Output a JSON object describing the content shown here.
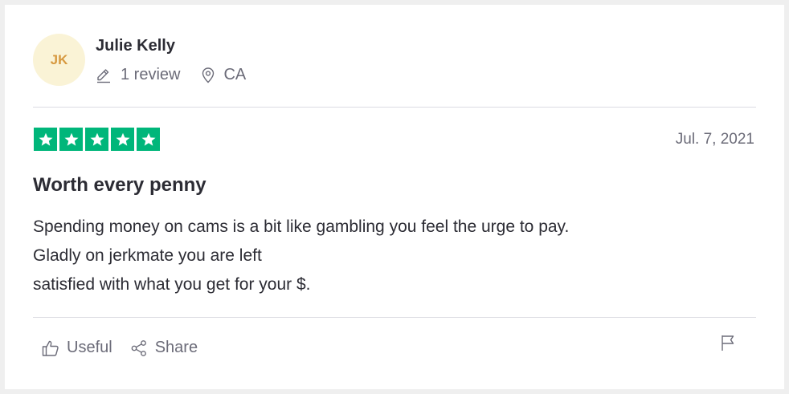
{
  "reviewer": {
    "initials": "JK",
    "name": "Julie Kelly",
    "review_count": "1 review",
    "location": "CA"
  },
  "review": {
    "rating": 5,
    "rating_max": 5,
    "date": "Jul. 7, 2021",
    "title": "Worth every penny",
    "body_lines": [
      "Spending money on cams is a bit like gambling you feel the urge to pay.",
      "Gladly on jerkmate you are left",
      "satisfied with what you get for your $."
    ]
  },
  "actions": {
    "useful_label": "Useful",
    "share_label": "Share"
  },
  "colors": {
    "star_green": "#00b67a",
    "avatar_bg": "#faf3d6",
    "avatar_text": "#d79940",
    "text_primary": "#2c2c34",
    "text_secondary": "#6b6b78",
    "page_bg": "#efefef"
  },
  "icons": [
    "pencil-icon",
    "location-pin-icon",
    "star-icon",
    "thumbs-up-icon",
    "share-icon",
    "flag-icon"
  ]
}
